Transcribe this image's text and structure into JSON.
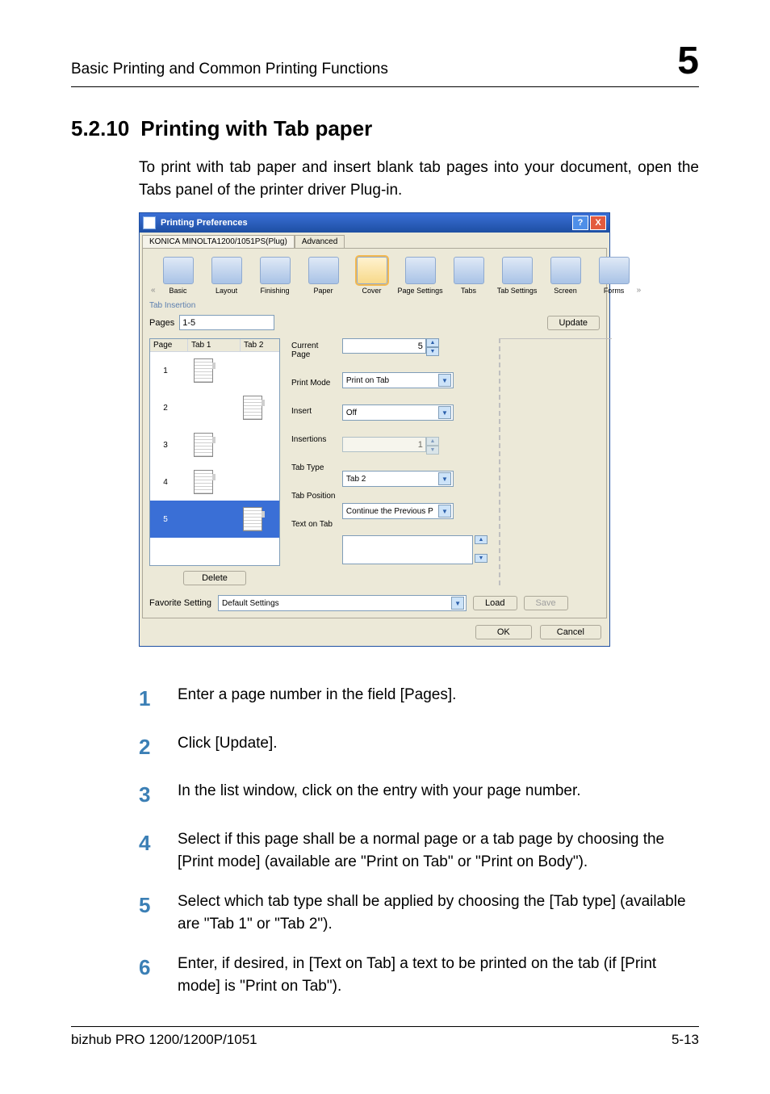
{
  "header": {
    "running_title": "Basic Printing and Common Printing Functions",
    "chapter_number": "5"
  },
  "section": {
    "number": "5.2.10",
    "title": "Printing with Tab paper",
    "intro": "To print with tab paper and insert blank tab pages into your document, open the Tabs panel of the printer driver Plug-in."
  },
  "dialog": {
    "title": "Printing Preferences",
    "subtabs": {
      "active": "KONICA MINOLTA1200/1051PS(Plug)",
      "other": "Advanced"
    },
    "iconbar": {
      "items": [
        "Basic",
        "Layout",
        "Finishing",
        "Paper",
        "Cover",
        "Page Settings",
        "Tabs",
        "Tab Settings",
        "Screen",
        "Forms"
      ],
      "selected_index": 4
    },
    "panel_label": "Tab Insertion",
    "pages_label": "Pages",
    "pages_value": "1-5",
    "update_btn": "Update",
    "list": {
      "headers": [
        "Page",
        "Tab 1",
        "Tab 2"
      ],
      "rows": [
        {
          "n": "1",
          "tab1": true,
          "tab2": false
        },
        {
          "n": "2",
          "tab1": false,
          "tab2": true
        },
        {
          "n": "3",
          "tab1": true,
          "tab2": false
        },
        {
          "n": "4",
          "tab1": true,
          "tab2": false,
          "left": true
        },
        {
          "n": "5",
          "tab1": false,
          "tab2": true,
          "selected": true
        }
      ]
    },
    "delete_btn": "Delete",
    "props": {
      "current_page_lbl": "Current Page",
      "current_page_val": "5",
      "print_mode_lbl": "Print Mode",
      "print_mode_val": "Print on Tab",
      "insert_lbl": "Insert",
      "insert_val": "Off",
      "insertions_lbl": "Insertions",
      "insertions_val": "1",
      "tab_type_lbl": "Tab Type",
      "tab_type_val": "Tab 2",
      "tab_position_lbl": "Tab Position",
      "tab_position_val": "Continue the Previous P",
      "text_on_tab_lbl": "Text on Tab"
    },
    "favorite": {
      "label": "Favorite Setting",
      "value": "Default Settings",
      "load": "Load",
      "save": "Save"
    },
    "ok": "OK",
    "cancel": "Cancel",
    "help": "?",
    "close": "X"
  },
  "steps": [
    "Enter a page number in the field [Pages].",
    "Click [Update].",
    "In the list window, click on the entry with your page number.",
    "Select if this page shall be a normal page or a tab page by choosing the [Print mode] (available are \"Print on Tab\" or \"Print on Body\").",
    "Select which tab type shall be applied by choosing the [Tab type] (available are \"Tab 1\" or \"Tab 2\").",
    "Enter, if desired, in [Text on Tab] a text to be printed on the tab (if [Print mode] is \"Print on Tab\")."
  ],
  "footer": {
    "left": "bizhub PRO 1200/1200P/1051",
    "right": "5-13"
  }
}
